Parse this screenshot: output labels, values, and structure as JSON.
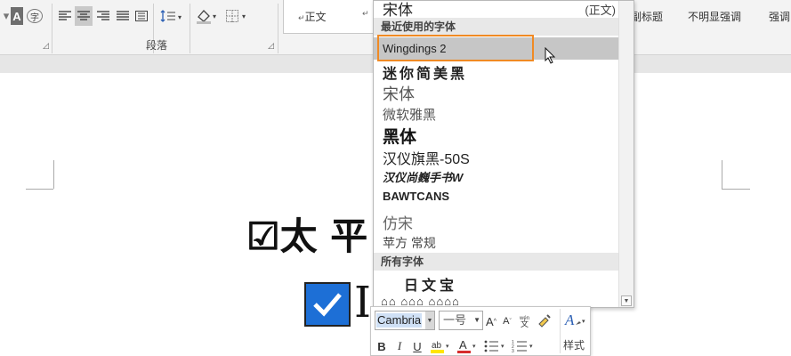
{
  "ribbon": {
    "group_label": "段落",
    "styles": {
      "items": [
        "正文",
        "副标题",
        "不明显强调",
        "强调"
      ]
    },
    "icons": [
      "A",
      "字"
    ]
  },
  "document": {
    "line1": "☑太 平",
    "line2": "I"
  },
  "font_dropdown": {
    "top_font": "宋体",
    "top_hint": "(正文)",
    "recent_header": "最近使用的字体",
    "recent_fonts": [
      "Wingdings 2",
      "迷你简美黑",
      "宋体",
      "微软雅黑",
      "黑体",
      "汉仪旗黑-50S",
      "汉仪尚巍手书W",
      "BAWTCANS",
      "仿宋",
      "苹方 常规"
    ],
    "all_header": "所有字体",
    "all_fonts": [
      "日文宝",
      "⌂⌂ ⌂⌂⌂ ⌂⌂⌂⌂"
    ]
  },
  "mini_toolbar": {
    "font": "Cambria",
    "size": "一号",
    "styles_label": "样式",
    "buttons": [
      "B",
      "I",
      "U"
    ]
  },
  "colors": {
    "accent_orange": "#f08a24",
    "highlight": "#c6c6c6",
    "checkbox_blue": "#1d6fd6",
    "font_color_red": "#d62c2c"
  }
}
